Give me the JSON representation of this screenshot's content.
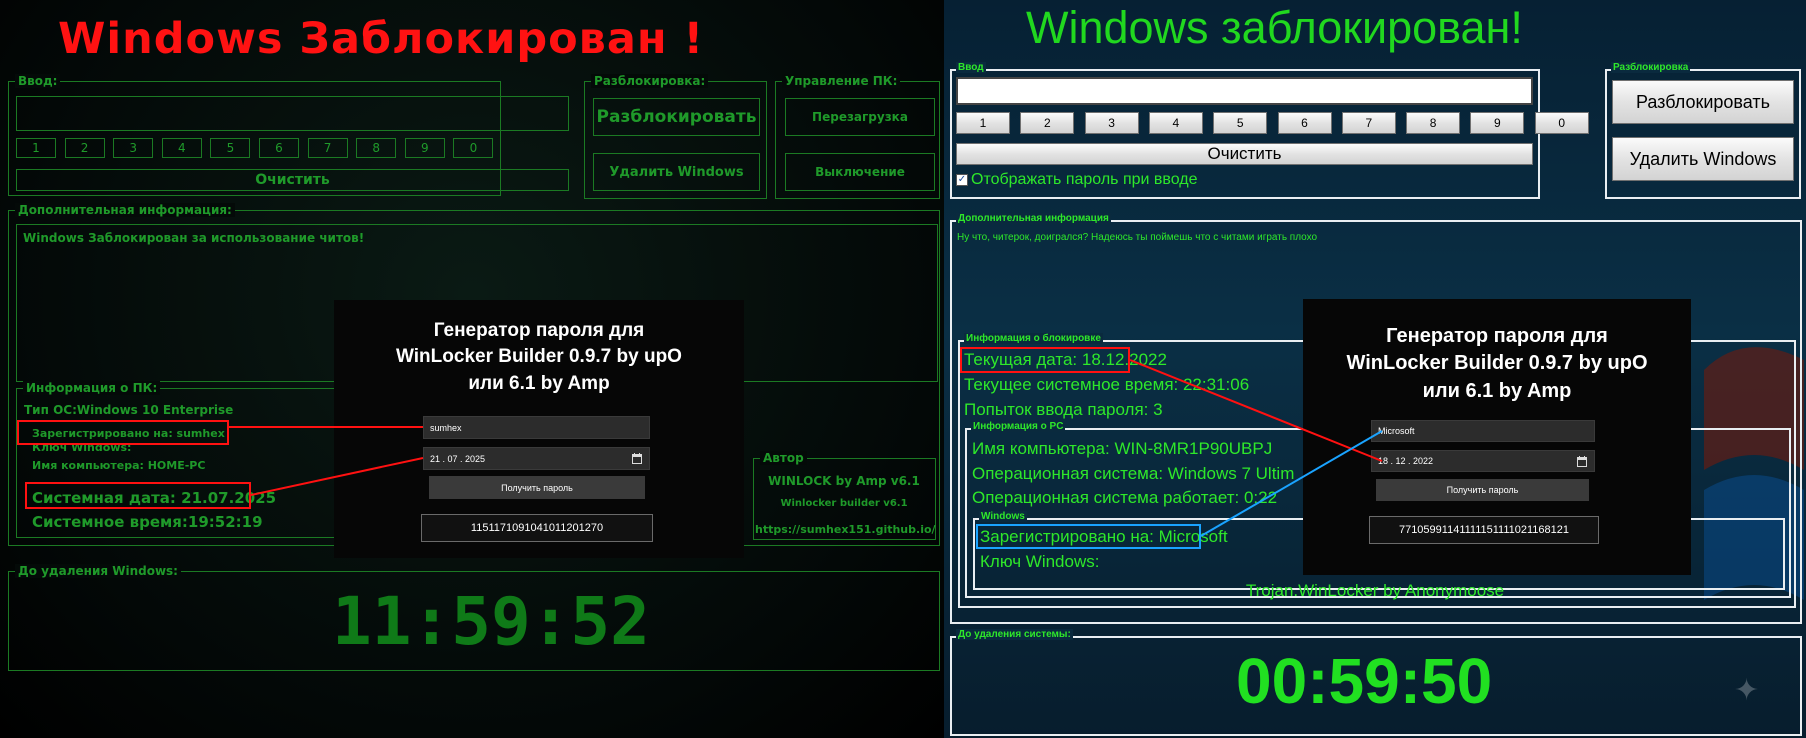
{
  "left": {
    "title": "Windows Заблокирован !",
    "input_section": {
      "legend": "Ввод:",
      "keys": [
        "1",
        "2",
        "3",
        "4",
        "5",
        "6",
        "7",
        "8",
        "9",
        "0"
      ],
      "clear_label": "Очистить"
    },
    "unlock_section": {
      "legend": "Разблокировка:",
      "unlock_label": "Разблокировать",
      "delete_label": "Удалить Windows"
    },
    "control_section": {
      "legend": "Управление ПК:",
      "restart_label": "Перезагрузка",
      "shutdown_label": "Выключение"
    },
    "extra_info": {
      "legend": "Дополнительная информация:",
      "text": "Windows Заблокирован за использование читов!"
    },
    "pc_info": {
      "legend": "Информация о ПК:",
      "os_line": "Тип ОС:Windows 10 Enterprise",
      "registered_line": "Зарегистрировано на: sumhex",
      "key_line": "Ключ Windows:",
      "computer_line": "Имя компьютера: HOME-PC",
      "date_line": "Системная дата: 21.07.2025",
      "time_line": "Системное время:19:52:19"
    },
    "author": {
      "legend": "Автор",
      "line1": "WINLOCK by Amp v6.1",
      "line2": "Winlocker builder v6.1",
      "line3": "https://sumhex151.github.io/"
    },
    "countdown": {
      "legend": "До удаления Windows:",
      "time": "11:59:52"
    },
    "popup": {
      "title_line1": "Генератор пароля для",
      "title_line2": "WinLocker Builder 0.9.7 by upO",
      "title_line3": "или 6.1 by Amp",
      "name_value": "sumhex",
      "date_value": "21 . 07 . 2025",
      "button_label": "Получить пароль",
      "result": "1151171091041011201270"
    }
  },
  "right": {
    "title": "Windows заблокирован!",
    "input_section": {
      "legend": "Ввод",
      "keys": [
        "1",
        "2",
        "3",
        "4",
        "5",
        "6",
        "7",
        "8",
        "9",
        "0"
      ],
      "clear_label": "Очистить",
      "show_password_label": "Отображать пароль при вводе",
      "show_password_checked": true
    },
    "unlock_section": {
      "legend": "Разблокировка",
      "unlock_label": "Разблокировать",
      "delete_label": "Удалить Windows"
    },
    "extra_info": {
      "legend": "Дополнительная информация",
      "text": "Ну что, читерок, доигрался? Надеюсь ты поймешь что с читами играть плохо"
    },
    "lock_info": {
      "legend": "Информация о блокировке",
      "date_line": "Текущая дата: 18.12.2022",
      "time_line": "Текущее системное время: 22:31:06",
      "attempts_line": "Попыток ввода пароля: 3"
    },
    "pc_info": {
      "legend": "Информация о PC",
      "computer_line": "Имя компьютера: WIN-8MR1P90UBPJ",
      "os_line": "Операционная система: Windows 7 Ultim",
      "uptime_line": "Операционная система работает:  0:22"
    },
    "windows_info": {
      "legend": "Windows",
      "registered_line": "Зарегистрировано на:  Microsoft",
      "key_line": "Ключ Windows:"
    },
    "footer": "Trojan.WinLocker by Anonymoose",
    "countdown": {
      "legend": "До удаления системы:",
      "time": "00:59:50"
    },
    "popup": {
      "title_line1": "Генератор пароля для",
      "title_line2": "WinLocker Builder 0.9.7 by upO",
      "title_line3": "или 6.1 by Amp",
      "name_value": "Microsoft",
      "date_value": "18 . 12 . 2022",
      "button_label": "Получить пароль",
      "result": "77105991141111151111021168121"
    }
  },
  "colors": {
    "left_red": "#ff1212",
    "left_green": "#1f9a2a",
    "right_green": "#2ee82a",
    "highlight_red": "#ff1111",
    "highlight_blue": "#1aa3ff"
  }
}
